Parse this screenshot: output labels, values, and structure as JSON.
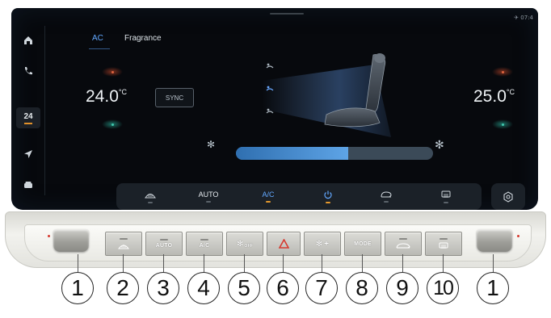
{
  "screen": {
    "status_text": "07:4",
    "tabs": [
      "AC",
      "Fragrance"
    ],
    "sidebar": {
      "icons": [
        "home-icon",
        "phone-icon",
        "climate-icon",
        "navigation-icon",
        "car-icon"
      ],
      "temp_chip": "24"
    },
    "driver_temp": "24.0",
    "passenger_temp": "25.0",
    "temp_unit": "°C",
    "sync_label": "SYNC",
    "fan_level_fraction": 0.57,
    "controls": [
      "AUTO",
      "A/C"
    ],
    "colors": {
      "accent_blue": "#62a8ff",
      "led_on": "#e69a2e",
      "screen_bg": "#07090d",
      "strip_bg": "#1b2128"
    }
  },
  "hardware_buttons": [
    {
      "id": "defrost-front",
      "label": "",
      "glyph": "front-defrost-icon"
    },
    {
      "id": "auto",
      "label": "AUTO"
    },
    {
      "id": "ac",
      "label": "A/C"
    },
    {
      "id": "fan-off",
      "label": "OFF",
      "glyph": "fan-icon"
    },
    {
      "id": "hazard",
      "label": "",
      "glyph": "hazard-icon"
    },
    {
      "id": "fan-plus",
      "label": "+",
      "glyph": "fan-icon"
    },
    {
      "id": "mode",
      "label": "MODE"
    },
    {
      "id": "recirculation",
      "label": "",
      "glyph": "recirculation-icon"
    },
    {
      "id": "rear-defrost",
      "label": "",
      "glyph": "rear-defrost-icon"
    }
  ],
  "callouts": [
    "1",
    "2",
    "3",
    "4",
    "5",
    "6",
    "7",
    "8",
    "9",
    "10",
    "1"
  ]
}
